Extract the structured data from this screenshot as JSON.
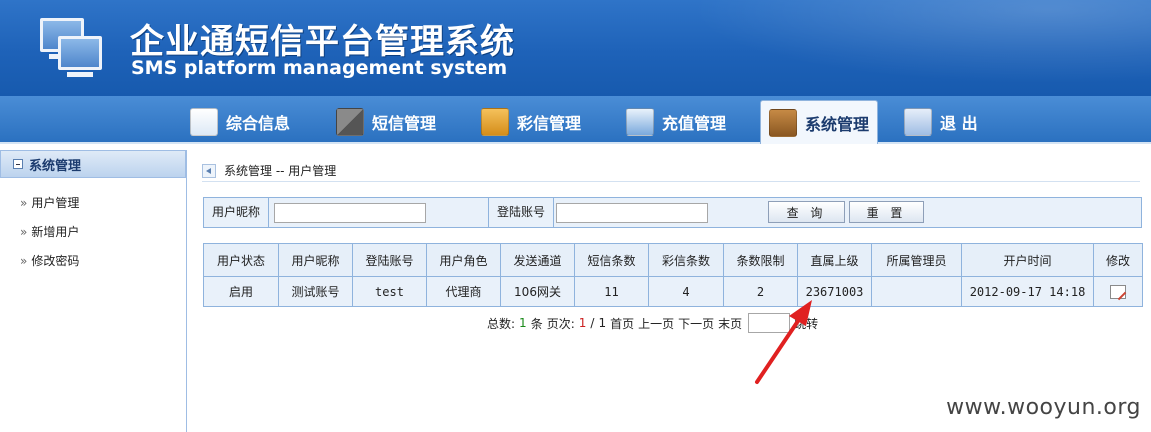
{
  "header": {
    "title_cn": "企业通短信平台管理系统",
    "title_en": "SMS platform management system"
  },
  "nav": {
    "items": [
      {
        "label": "综合信息",
        "icon": "user-card-icon"
      },
      {
        "label": "短信管理",
        "icon": "sms-grid-icon"
      },
      {
        "label": "彩信管理",
        "icon": "mms-book-icon"
      },
      {
        "label": "充值管理",
        "icon": "chart-icon"
      },
      {
        "label": "系统管理",
        "icon": "system-wallet-icon",
        "active": true
      },
      {
        "label": "退 出",
        "icon": "exit-list-icon"
      }
    ]
  },
  "sidebar": {
    "title": "系统管理",
    "items": [
      {
        "label": "用户管理"
      },
      {
        "label": "新增用户"
      },
      {
        "label": "修改密码"
      }
    ]
  },
  "breadcrumb": "系统管理 -- 用户管理",
  "search": {
    "nickname_label": "用户昵称",
    "nickname_value": "",
    "account_label": "登陆账号",
    "account_value": "",
    "query_button": "查 询",
    "reset_button": "重 置"
  },
  "table": {
    "headers": [
      "用户状态",
      "用户昵称",
      "登陆账号",
      "用户角色",
      "发送通道",
      "短信条数",
      "彩信条数",
      "条数限制",
      "直属上级",
      "所属管理员",
      "开户时间",
      "修改"
    ],
    "rows": [
      [
        "启用",
        "测试账号",
        "test",
        "代理商",
        "106网关",
        "11",
        "4",
        "2",
        "23671003",
        "",
        "2012-09-17 14:18",
        ""
      ]
    ]
  },
  "pager": {
    "total_label": "总数:",
    "total": "1",
    "unit": "条",
    "page_label": "页次:",
    "current": "1",
    "sep": "/",
    "pages": "1",
    "first": "首页",
    "prev": "上一页",
    "next": "下一页",
    "last": "末页",
    "jump": "跳转",
    "jump_value": ""
  },
  "watermark": "www.wooyun.org",
  "colors": {
    "header_blue": "#1e62b8",
    "panel_bg": "#e9f1fa",
    "border_blue": "#8fb3dd",
    "annotation_red": "#e02020"
  }
}
